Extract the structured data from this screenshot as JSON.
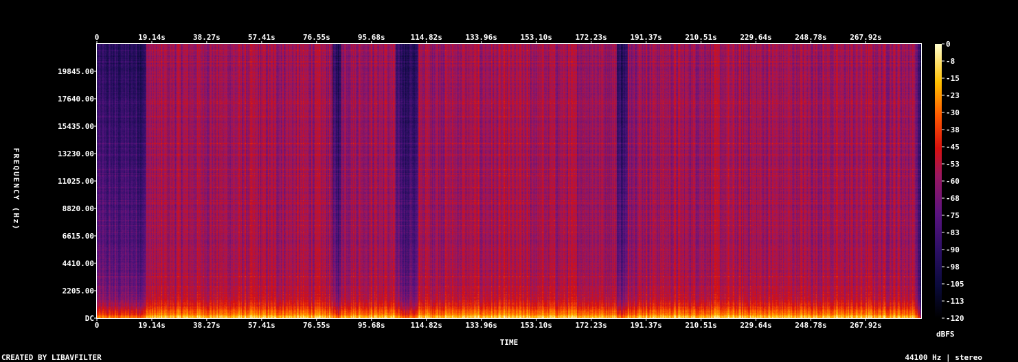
{
  "chart_data": {
    "type": "heatmap",
    "title": "",
    "xlabel": "TIME",
    "ylabel": "FREQUENCY (Hz)",
    "x_ticks": [
      "0",
      "19.14s",
      "38.27s",
      "57.41s",
      "76.55s",
      "95.68s",
      "114.82s",
      "133.96s",
      "153.10s",
      "172.23s",
      "191.37s",
      "210.51s",
      "229.64s",
      "248.78s",
      "267.92s"
    ],
    "x_tick_values_s": [
      0,
      19.14,
      38.27,
      57.41,
      76.55,
      95.68,
      114.82,
      133.96,
      153.1,
      172.23,
      191.37,
      210.51,
      229.64,
      248.78,
      267.92
    ],
    "xlim_s": [
      0,
      287.2
    ],
    "y_ticks": [
      "DC",
      "2205.00",
      "4410.00",
      "6615.00",
      "8820.00",
      "11025.00",
      "13230.00",
      "15435.00",
      "17640.00",
      "19845.00"
    ],
    "y_tick_values_hz": [
      0,
      2205,
      4410,
      6615,
      8820,
      11025,
      13230,
      15435,
      17640,
      19845
    ],
    "ylim_hz": [
      0,
      22050
    ],
    "colorbar": {
      "label": "dBFS",
      "ticks": [
        "0",
        "-8",
        "-15",
        "-23",
        "-30",
        "-38",
        "-45",
        "-53",
        "-60",
        "-68",
        "-75",
        "-83",
        "-90",
        "-98",
        "-105",
        "-113",
        "-120"
      ],
      "range_db": [
        -120,
        0
      ],
      "colormap": "intensity (black-navy-purple-red-orange-yellow-white)"
    },
    "features": {
      "quiet_intervals_s": [
        [
          0,
          17
        ],
        [
          82,
          85
        ],
        [
          104,
          112
        ],
        [
          181,
          185
        ]
      ],
      "background_db_at_high_freq": -60,
      "bass_db": -15,
      "end_fade_s": 285
    }
  },
  "footer": {
    "left": "CREATED BY LIBAVFILTER",
    "right": "44100 Hz | stereo"
  },
  "colors": {
    "background": "#000000",
    "text": "#ffffff",
    "ramp": [
      "#000000",
      "#0a0a3c",
      "#2c0f66",
      "#5a1380",
      "#9a1760",
      "#d8100e",
      "#ff5a00",
      "#ffc000",
      "#ffffd0"
    ]
  }
}
